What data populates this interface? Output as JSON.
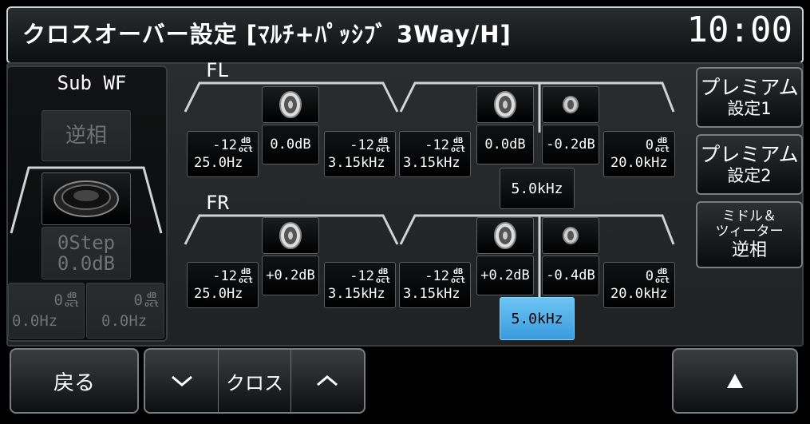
{
  "header": {
    "title": "クロスオーバー設定 [ﾏﾙﾁ+ﾊﾟｯｼﾌﾞ 3Way/H]",
    "clock": "10:00"
  },
  "subwf": {
    "label": "Sub WF",
    "phase_label": "逆相",
    "step": "0Step",
    "gain": "0.0dB",
    "left_slope": "0",
    "left_freq": "0.0Hz",
    "right_slope": "0",
    "right_freq": "0.0Hz"
  },
  "units": {
    "db": "dB",
    "oct": "oct"
  },
  "channels": {
    "fl": {
      "label": "FL",
      "woofer": {
        "hpf_slope": "-12",
        "hpf_freq": "25.0Hz",
        "gain": "0.0dB",
        "lpf_slope": "-12",
        "lpf_freq": "3.15kHz"
      },
      "mid": {
        "hpf_slope": "-12",
        "hpf_freq": "3.15kHz",
        "gain": "0.0dB"
      },
      "tweeter": {
        "gain": "-0.2dB",
        "lpf_slope": "0",
        "lpf_freq": "20.0kHz"
      },
      "cross_freq": "5.0kHz"
    },
    "fr": {
      "label": "FR",
      "woofer": {
        "hpf_slope": "-12",
        "hpf_freq": "25.0Hz",
        "gain": "+0.2dB",
        "lpf_slope": "-12",
        "lpf_freq": "3.15kHz"
      },
      "mid": {
        "hpf_slope": "-12",
        "hpf_freq": "3.15kHz",
        "gain": "+0.2dB"
      },
      "tweeter": {
        "gain": "-0.4dB",
        "lpf_slope": "0",
        "lpf_freq": "20.0kHz"
      },
      "cross_freq": "5.0kHz"
    }
  },
  "side_buttons": {
    "premium1_line1": "プレミアム",
    "premium1_line2": "設定1",
    "premium2_line1": "プレミアム",
    "premium2_line2": "設定2",
    "invert_line1": "ミドル＆",
    "invert_line2": "ツィーター",
    "invert_line3": "逆相"
  },
  "footer": {
    "back": "戻る",
    "cross": "クロス",
    "down_icon": "chevron-down-icon",
    "up_icon": "chevron-up-icon",
    "eject_icon": "triangle-up-icon"
  },
  "colors": {
    "active": "#4aaee8",
    "frame": "#cfd3d6"
  }
}
